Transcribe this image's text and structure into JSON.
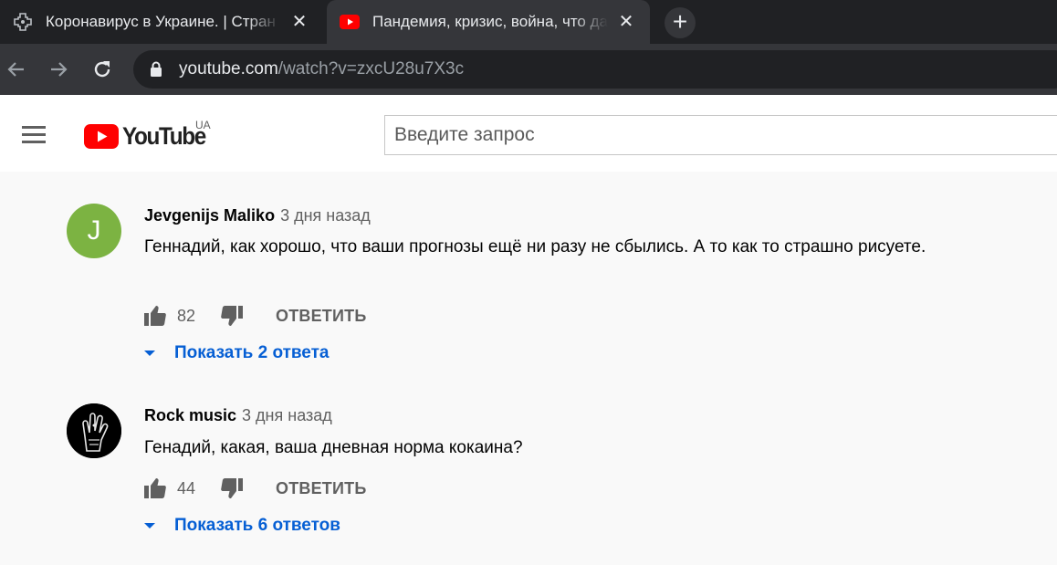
{
  "browser": {
    "tabs": [
      {
        "title": "Коронавирус в Украине. | Стран",
        "active": false
      },
      {
        "title": "Пандемия, кризис, война, что дальше",
        "active": true
      }
    ],
    "url_host": "youtube.com",
    "url_path": "/watch?v=zxcU28u7X3c"
  },
  "header": {
    "logo_text": "YouTube",
    "region": "UA",
    "search_placeholder": "Введите запрос"
  },
  "comments": [
    {
      "author": "Jevgenijs Maliko",
      "time": "3 дня назад",
      "avatar_letter": "J",
      "avatar_color": "#7cb342",
      "text": "Геннадий, как хорошо, что ваши прогнозы ещё ни разу не сбылись. А то как то страшно рисуете.",
      "likes": "82",
      "reply_label": "ОТВЕТИТЬ",
      "show_replies": "Показать 2 ответа"
    },
    {
      "author": "Rock music",
      "time": "3 дня назад",
      "text": "Генадий, какая, ваша дневная норма кокаина?",
      "likes": "44",
      "reply_label": "ОТВЕТИТЬ",
      "show_replies": "Показать 6 ответов"
    }
  ],
  "colors": {
    "brand_red": "#ff0000",
    "link_blue": "#065fd4",
    "chrome_dark": "#202124",
    "chrome_toolbar": "#35363a"
  }
}
